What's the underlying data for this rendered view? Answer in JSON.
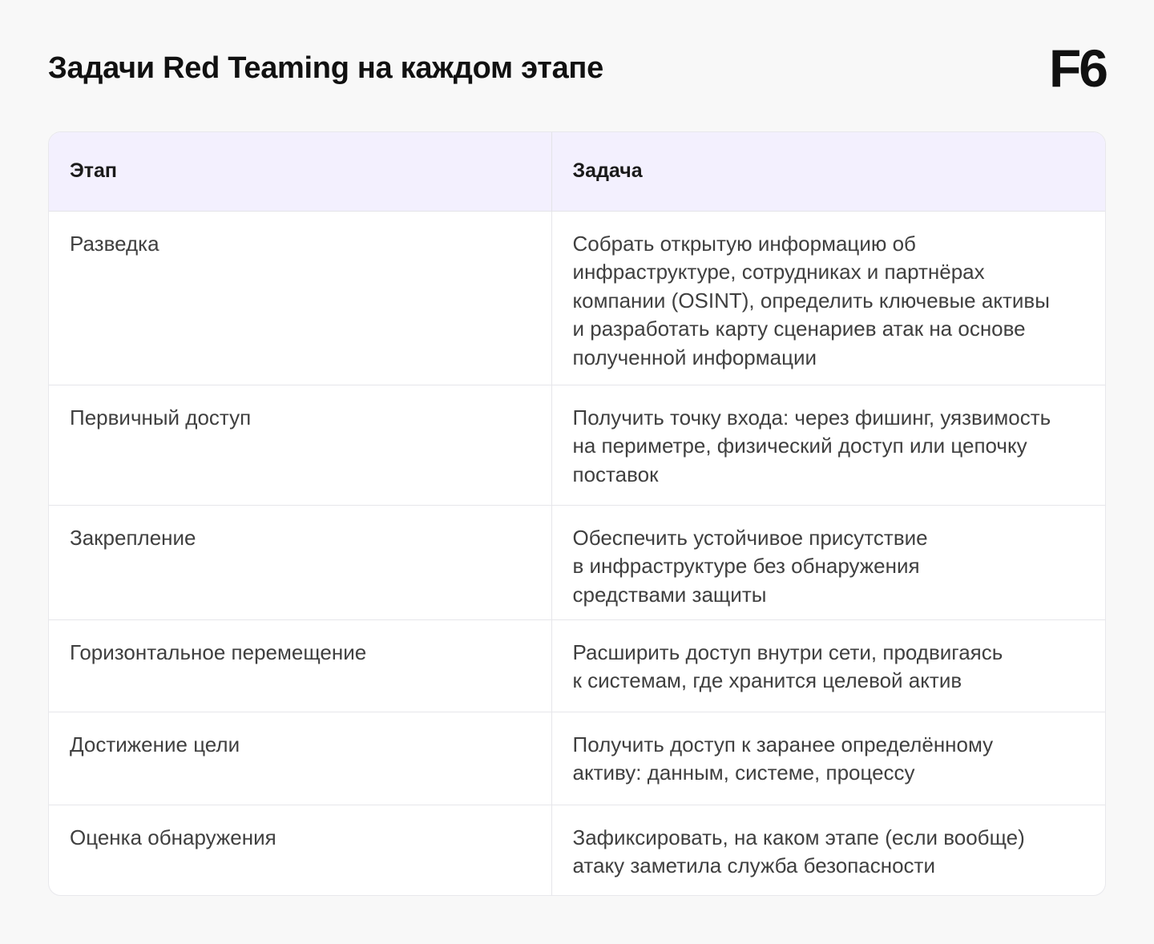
{
  "header": {
    "title": "Задачи Red Teaming на каждом этапе",
    "logo": "F6"
  },
  "table": {
    "columns": [
      "Этап",
      "Задача"
    ],
    "rows": [
      {
        "stage": "Разведка",
        "task": "Собрать открытую информацию об\nинфраструктуре, сотрудниках и партнёрах\nкомпании (OSINT), определить ключевые активы\nи разработать карту сценариев атак на основе\nполученной информации"
      },
      {
        "stage": "Первичный доступ",
        "task": "Получить точку входа: через фишинг, уязвимость\nна периметре, физический доступ или цепочку\nпоставок"
      },
      {
        "stage": "Закрепление",
        "task": "Обеспечить устойчивое присутствие\nв инфраструктуре без обнаружения\nсредствами защиты"
      },
      {
        "stage": "Горизонтальное перемещение",
        "task": "Расширить доступ внутри сети, продвигаясь\nк системам, где хранится целевой актив"
      },
      {
        "stage": "Достижение цели",
        "task": "Получить доступ к заранее определённому\nактиву: данным, системе, процессу"
      },
      {
        "stage": "Оценка обнаружения",
        "task": "Зафиксировать, на каком этапе (если вообще)\nатаку заметила служба безопасности"
      }
    ]
  },
  "colors": {
    "page_background": "#f8f8f8",
    "header_row_background": "#f3f0fe",
    "text_primary": "#111111",
    "text_body": "#3f3f3f",
    "border": "#e6e6ea"
  }
}
